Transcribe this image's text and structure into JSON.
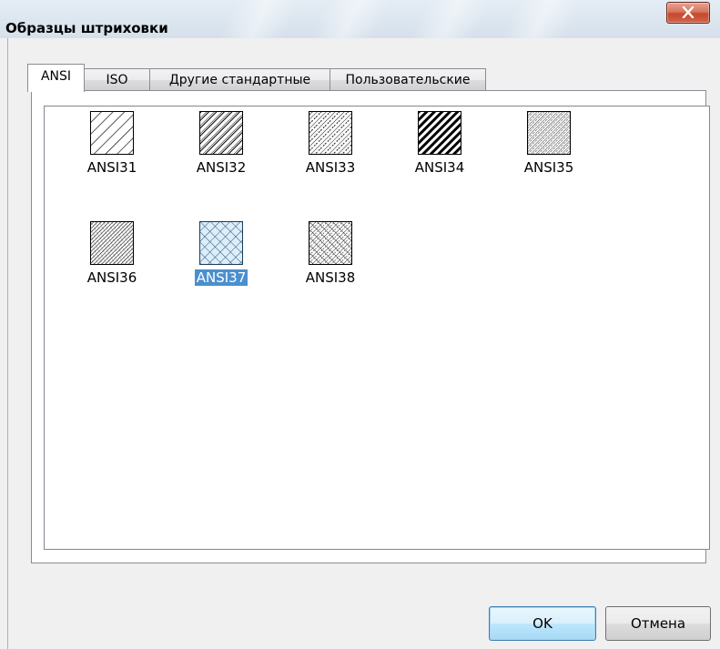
{
  "window": {
    "title": "Образцы штриховки",
    "close_glyph": "X"
  },
  "tabs": [
    {
      "label": "ANSI",
      "active": true
    },
    {
      "label": "ISO",
      "active": false
    },
    {
      "label": "Другие стандартные",
      "active": false
    },
    {
      "label": "Пользовательские",
      "active": false
    }
  ],
  "patterns": [
    {
      "name": "ANSI31",
      "icon": "hatch-diagonal-single-icon",
      "selected": false
    },
    {
      "name": "ANSI32",
      "icon": "hatch-diagonal-steel-icon",
      "selected": false
    },
    {
      "name": "ANSI33",
      "icon": "hatch-diagonal-dashed-icon",
      "selected": false
    },
    {
      "name": "ANSI34",
      "icon": "hatch-diagonal-thick-icon",
      "selected": false
    },
    {
      "name": "ANSI35",
      "icon": "hatch-diagonal-dense-icon",
      "selected": false
    },
    {
      "name": "ANSI36",
      "icon": "hatch-dense-crosshatch-icon",
      "selected": false
    },
    {
      "name": "ANSI37",
      "icon": "hatch-crosshatch-icon",
      "selected": true
    },
    {
      "name": "ANSI38",
      "icon": "hatch-crosshatch-dense-icon",
      "selected": false
    }
  ],
  "buttons": {
    "ok": "OK",
    "cancel": "Отмена"
  },
  "colors": {
    "selection": "#4a8fcf",
    "close_button": "#c24a30"
  }
}
